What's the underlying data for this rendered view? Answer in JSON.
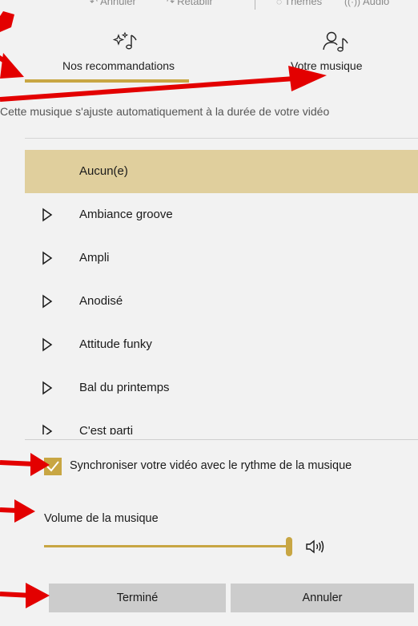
{
  "toolbar": {
    "undo_label": "Annuler",
    "redo_label": "Rétablir",
    "themes_label": "Thèmes",
    "audio_label": "Audio"
  },
  "tabs": [
    {
      "label": "Nos recommandations",
      "icon": "sparkle-music-icon",
      "selected": true
    },
    {
      "label": "Votre musique",
      "icon": "person-music-icon",
      "selected": false
    }
  ],
  "subtitle": "Cette musique s'ajuste automatiquement à la durée de votre vidéo",
  "music_list": {
    "items": [
      {
        "name": "Aucun(e)",
        "selected": true,
        "has_play": false
      },
      {
        "name": "Ambiance groove",
        "selected": false,
        "has_play": true
      },
      {
        "name": "Ampli",
        "selected": false,
        "has_play": true
      },
      {
        "name": "Anodisé",
        "selected": false,
        "has_play": true
      },
      {
        "name": "Attitude funky",
        "selected": false,
        "has_play": true
      },
      {
        "name": "Bal du printemps",
        "selected": false,
        "has_play": true
      },
      {
        "name": "C'est parti",
        "selected": false,
        "has_play": true
      }
    ]
  },
  "sync": {
    "label": "Synchroniser votre vidéo avec le rythme de la musique",
    "checked": true
  },
  "volume": {
    "label": "Volume de la musique",
    "level": 1.0,
    "icon": "speaker-icon"
  },
  "buttons": {
    "done": "Terminé",
    "cancel": "Annuler"
  },
  "colors": {
    "accent": "#c8a643",
    "selected_row": "#e0cf9d",
    "annotation_arrow": "#e30000",
    "button_bg": "#cccccc"
  }
}
